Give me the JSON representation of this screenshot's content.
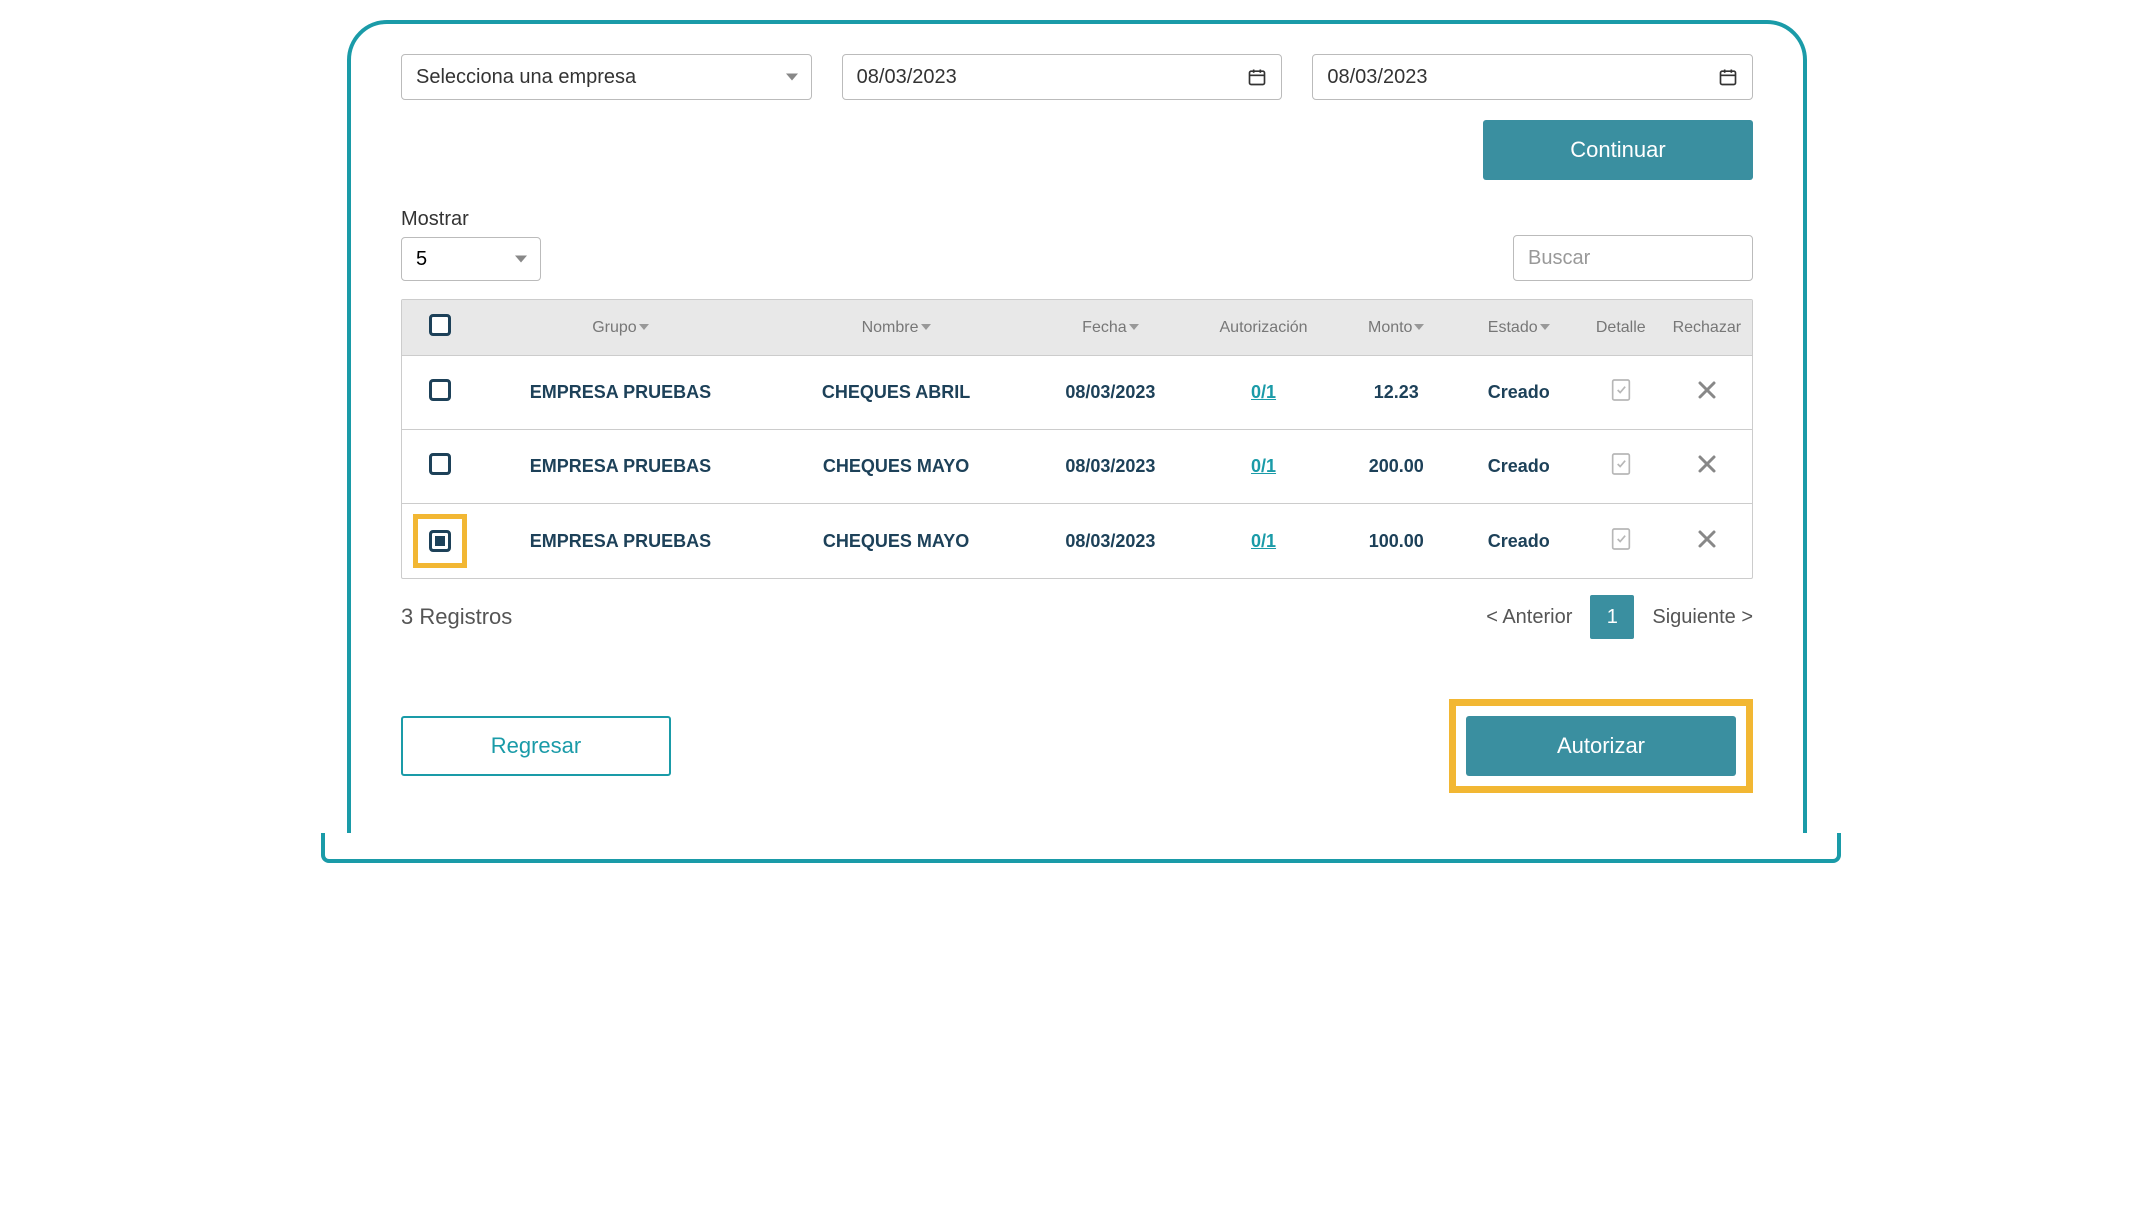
{
  "filters": {
    "empresa_placeholder": "Selecciona una empresa",
    "fecha_desde": "08/03/2023",
    "fecha_hasta": "08/03/2023"
  },
  "buttons": {
    "continuar": "Continuar",
    "regresar": "Regresar",
    "autorizar": "Autorizar"
  },
  "controls": {
    "mostrar_label": "Mostrar",
    "mostrar_value": "5",
    "buscar_placeholder": "Buscar"
  },
  "table": {
    "headers": {
      "grupo": "Grupo",
      "nombre": "Nombre",
      "fecha": "Fecha",
      "autorizacion": "Autorización",
      "monto": "Monto",
      "estado": "Estado",
      "detalle": "Detalle",
      "rechazar": "Rechazar"
    },
    "rows": [
      {
        "checked": false,
        "highlighted": false,
        "grupo": "EMPRESA PRUEBAS",
        "nombre": "CHEQUES ABRIL",
        "fecha": "08/03/2023",
        "autorizacion": "0/1",
        "monto": "12.23",
        "estado": "Creado"
      },
      {
        "checked": false,
        "highlighted": false,
        "grupo": "EMPRESA PRUEBAS",
        "nombre": "CHEQUES MAYO",
        "fecha": "08/03/2023",
        "autorizacion": "0/1",
        "monto": "200.00",
        "estado": "Creado"
      },
      {
        "checked": true,
        "highlighted": true,
        "grupo": "EMPRESA PRUEBAS",
        "nombre": "CHEQUES MAYO",
        "fecha": "08/03/2023",
        "autorizacion": "0/1",
        "monto": "100.00",
        "estado": "Creado"
      }
    ]
  },
  "footer": {
    "records": "3 Registros",
    "prev": "< Anterior",
    "page": "1",
    "next": "Siguiente >"
  }
}
